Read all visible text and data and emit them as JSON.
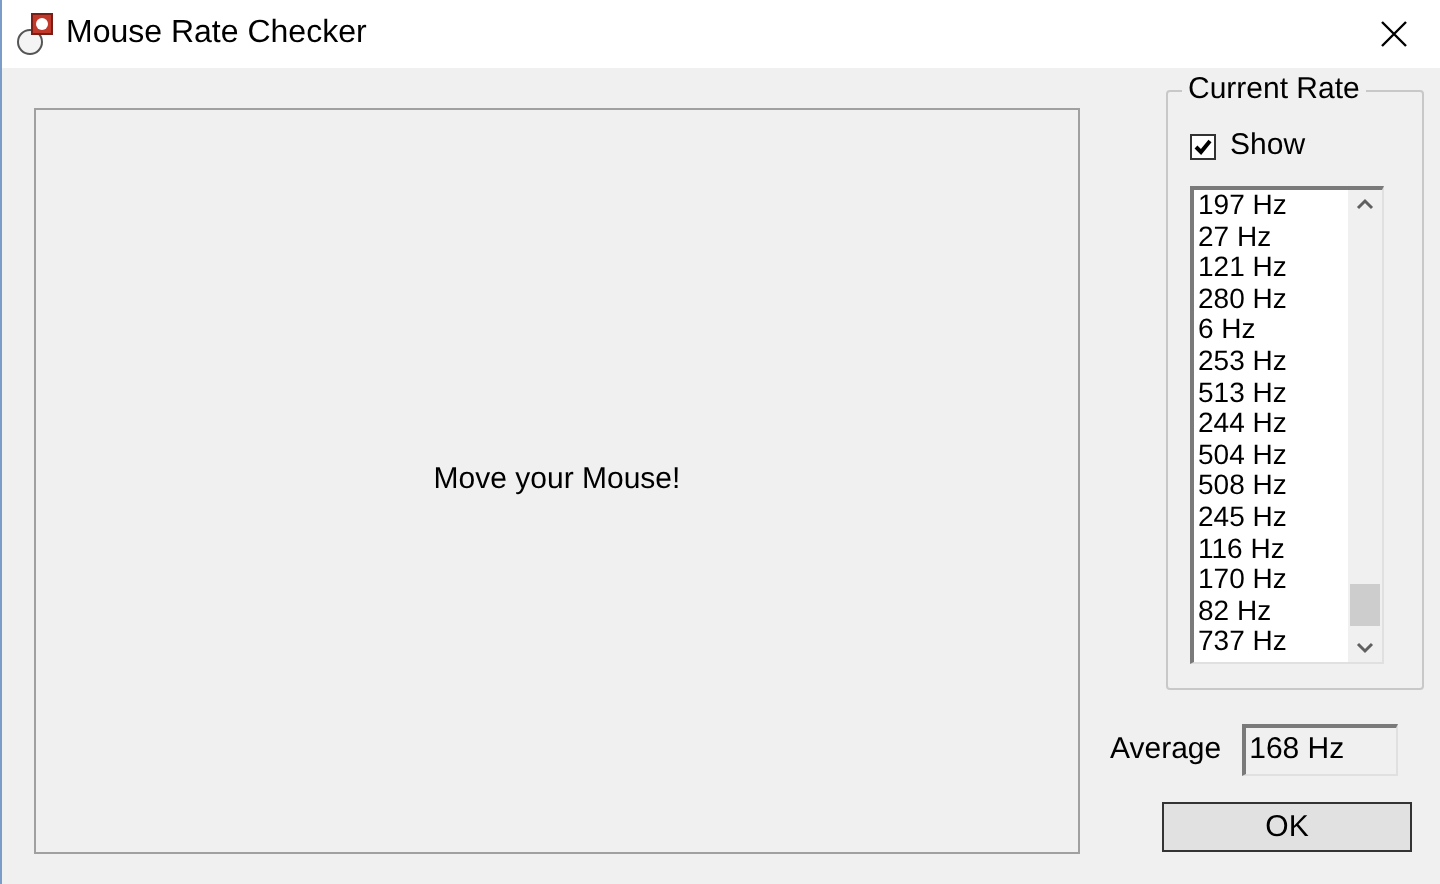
{
  "window": {
    "title": "Mouse Rate Checker"
  },
  "canvas": {
    "message": "Move your Mouse!"
  },
  "current_rate": {
    "title": "Current Rate",
    "show": {
      "label": "Show",
      "checked": true
    },
    "rates": [
      "197 Hz",
      "27 Hz",
      "121 Hz",
      "280 Hz",
      "6 Hz",
      "253 Hz",
      "513 Hz",
      "244 Hz",
      "504 Hz",
      "508 Hz",
      "245 Hz",
      "116 Hz",
      "170 Hz",
      "82 Hz",
      "737 Hz"
    ]
  },
  "average": {
    "label": "Average",
    "value": "168 Hz"
  },
  "buttons": [
    "OK"
  ]
}
